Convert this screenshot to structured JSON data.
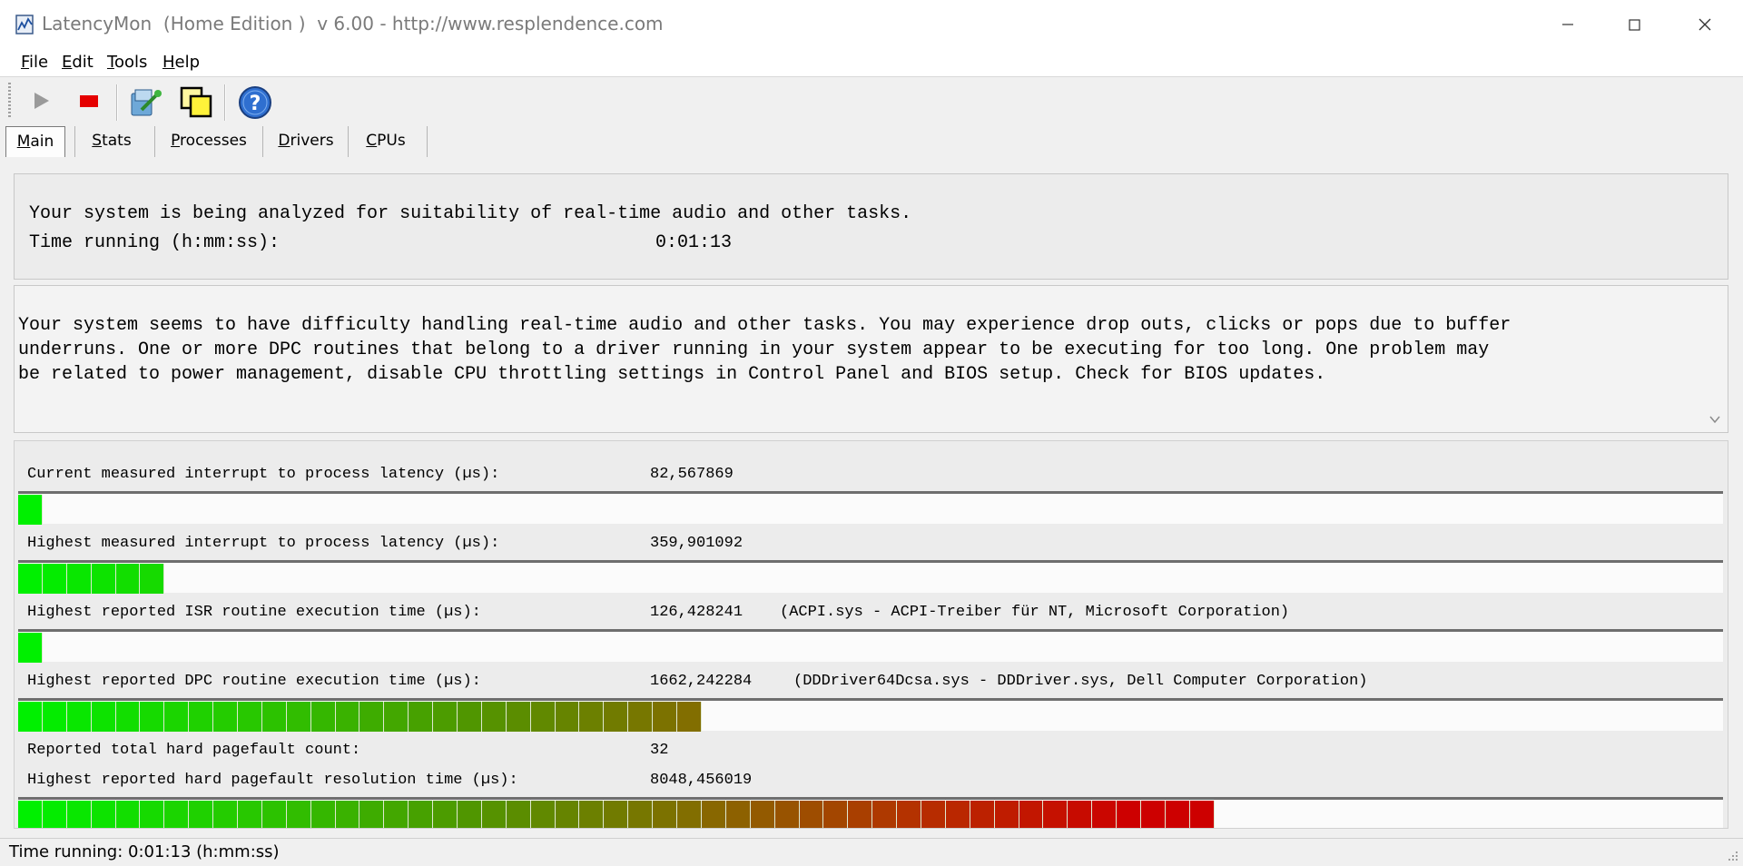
{
  "window": {
    "title": "LatencyMon  (Home Edition )  v 6.00 - http://www.resplendence.com"
  },
  "menu": [
    "File",
    "Edit",
    "Tools",
    "Help"
  ],
  "toolbar": {
    "icons": [
      "play-icon",
      "stop-icon",
      "driver-tool-icon",
      "windows-icon",
      "help-icon"
    ]
  },
  "tabs": [
    "Main",
    "Stats",
    "Processes",
    "Drivers",
    "CPUs"
  ],
  "analysis": {
    "heading": "Your system is being analyzed for suitability of real-time audio and other tasks.",
    "time_label": "Time running (h:mm:ss):",
    "time_value": "0:01:13"
  },
  "conclusion": {
    "text": "Your system seems to have difficulty handling real-time audio and other tasks. You may experience drop outs, clicks or pops due to buffer\nunderruns. One or more DPC routines that belong to a driver running in your system appear to be executing for too long. One problem may\nbe related to power management, disable CPU throttling settings in Control Panel and BIOS setup. Check for BIOS updates."
  },
  "metrics": [
    {
      "label": "Current measured interrupt to process latency (µs):",
      "value": "82,567869",
      "detail": "",
      "level": 0.021
    },
    {
      "label": "Highest measured interrupt to process latency (µs):",
      "value": "359,901092",
      "detail": "",
      "level": 0.086
    },
    {
      "label": "Highest reported ISR routine execution time (µs):",
      "value": "126,428241",
      "detail": "(ACPI.sys - ACPI-Treiber für NT, Microsoft Corporation)",
      "level": 0.021
    },
    {
      "label": "Highest reported DPC routine execution time (µs):",
      "value": "1662,242284",
      "detail": "(DDDriver64Dcsa.sys - DDDriver.sys, Dell Computer Corporation)",
      "level": 0.4
    },
    {
      "label": "Reported total hard pagefault count:",
      "value": "32",
      "detail": ""
    },
    {
      "label": "Highest reported hard pagefault resolution time (µs):",
      "value": "8048,456019",
      "detail": "",
      "level": 0.715
    }
  ],
  "status": {
    "text": "Time running: 0:01:13  (h:mm:ss)"
  }
}
